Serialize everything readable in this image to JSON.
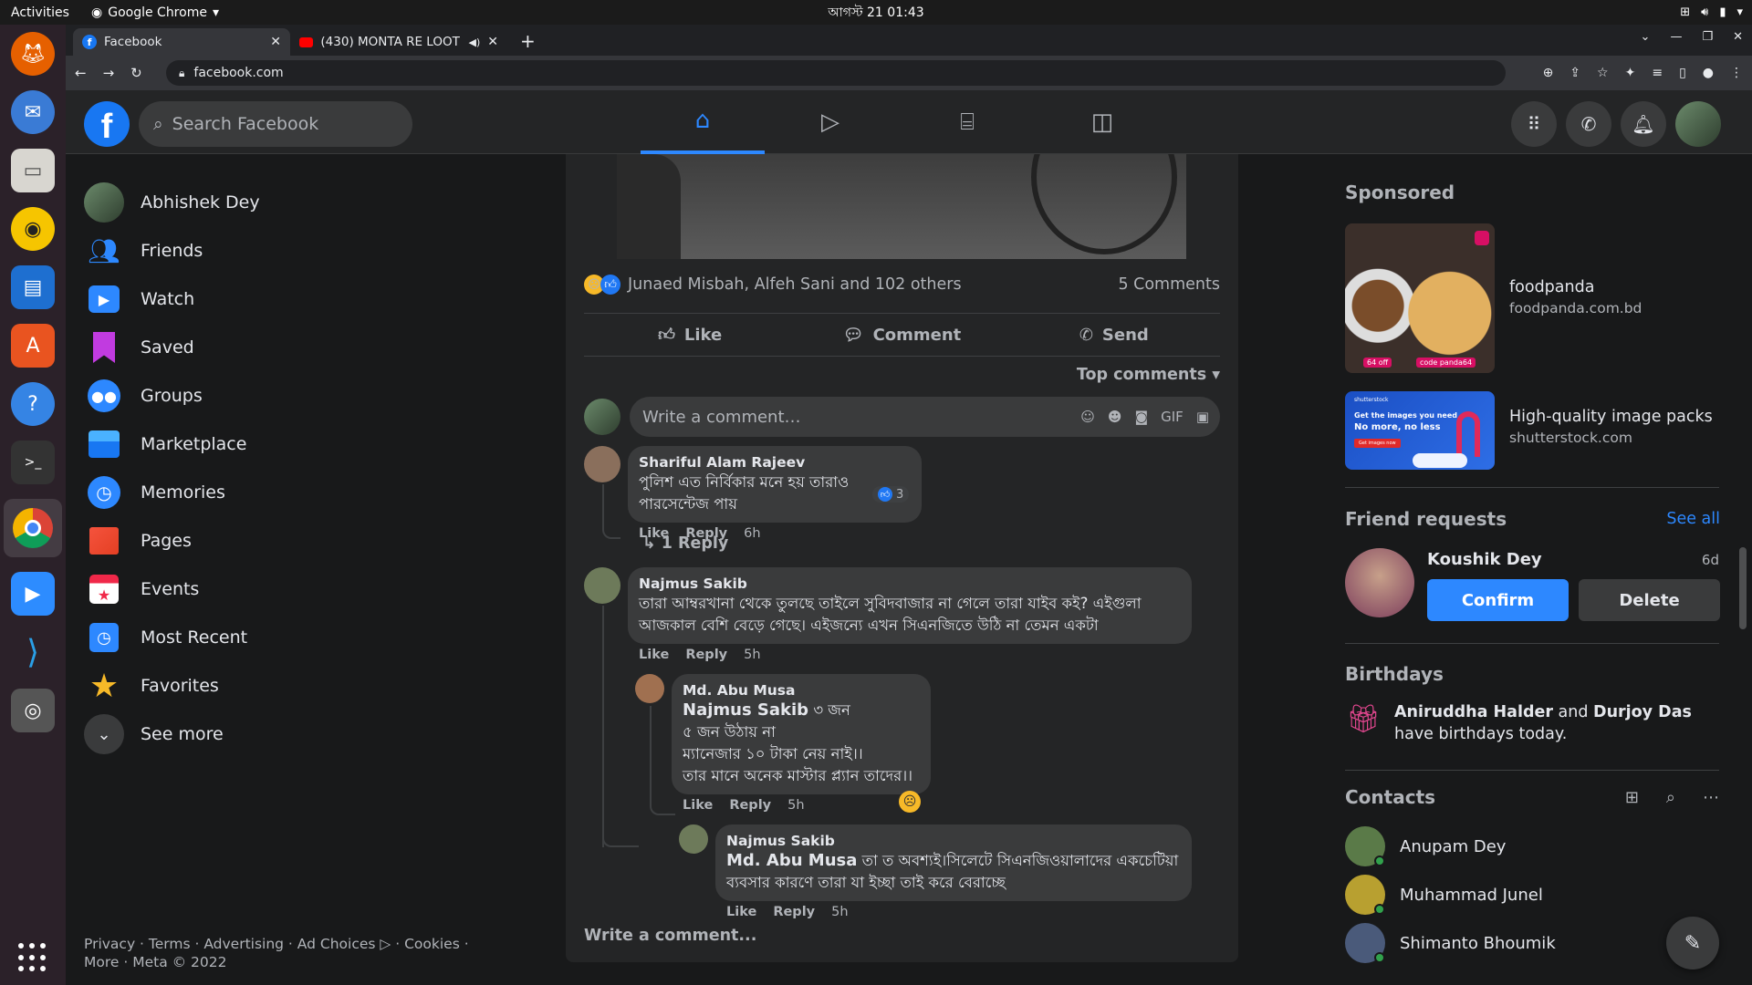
{
  "os": {
    "activities": "Activities",
    "app_name": "Google Chrome",
    "clock": "আগস্ট 21  01:43"
  },
  "browser": {
    "tabs": [
      {
        "title": "Facebook"
      },
      {
        "title": "(430) MONTA RE LOOT"
      }
    ],
    "url": "facebook.com"
  },
  "fb": {
    "search_placeholder": "Search Facebook",
    "colors": {
      "accent": "#2d88ff",
      "bg": "#18191a",
      "card": "#242526"
    }
  },
  "left_nav": {
    "items": [
      {
        "label": "Abhishek Dey",
        "icon": "profile-avatar"
      },
      {
        "label": "Friends",
        "icon": "friends-icon"
      },
      {
        "label": "Watch",
        "icon": "watch-icon"
      },
      {
        "label": "Saved",
        "icon": "bookmark-icon"
      },
      {
        "label": "Groups",
        "icon": "groups-icon"
      },
      {
        "label": "Marketplace",
        "icon": "marketplace-icon"
      },
      {
        "label": "Memories",
        "icon": "clock-icon"
      },
      {
        "label": "Pages",
        "icon": "flag-icon"
      },
      {
        "label": "Events",
        "icon": "calendar-icon"
      },
      {
        "label": "Most Recent",
        "icon": "feed-icon"
      },
      {
        "label": "Favorites",
        "icon": "star-icon"
      },
      {
        "label": "See more",
        "icon": "chevron-down-icon"
      }
    ],
    "footer": "Privacy · Terms · Advertising · Ad Choices ▷ · Cookies · More · Meta © 2022"
  },
  "post": {
    "reactions_text": "Junaed Misbah, Alfeh Sani and 102 others",
    "comments_count": "5 Comments",
    "actions": {
      "like": "Like",
      "comment": "Comment",
      "send": "Send"
    },
    "sort_label": "Top comments",
    "write_placeholder": "Write a comment…",
    "write_bottom": "Write a comment...",
    "comments": [
      {
        "author": "Shariful Alam Rajeev",
        "text": "পুলিশ এত নির্বিকার মনে হয় তারাও পারসেন্টেজ পায়",
        "like": "Like",
        "reply": "Reply",
        "time": "6h",
        "likes": "3",
        "replies_link": "1 Reply"
      },
      {
        "author": "Najmus Sakib",
        "text": "তারা আম্বরখানা থেকে তুলছে তাইলে সুবিদবাজার না গেলে তারা যাইব কই? এইগুলা আজকাল বেশি বেড়ে গেছে। এইজন্যে এখন সিএনজিতে উঠি না তেমন একটা",
        "like": "Like",
        "reply": "Reply",
        "time": "5h"
      },
      {
        "author": "Md. Abu Musa",
        "mention": "Najmus Sakib",
        "text_after_mention": " ৩ জন",
        "lines": [
          "৫ জন উঠায় না",
          "ম্যানেজার ১০ টাকা নেয় নাই।।",
          "তার মানে অনেক মাস্টার প্ল্যান তাদের।।"
        ],
        "like": "Like",
        "reply": "Reply",
        "time": "5h"
      },
      {
        "author": "Najmus Sakib",
        "mention": "Md. Abu Musa",
        "text_after_mention": " তা ত অবশ্যই।সিলেটে সিএনজিওয়ালাদের একচেটিয়া",
        "line2": "ব্যবসার কারণে তারা যা ইচ্ছা তাই করে বেরাচ্ছে",
        "like": "Like",
        "reply": "Reply",
        "time": "5h"
      }
    ]
  },
  "right": {
    "sponsored_title": "Sponsored",
    "ads": [
      {
        "name": "foodpanda",
        "domain": "foodpanda.com.bd",
        "banner_text": [
          "64 off",
          "code panda64"
        ]
      },
      {
        "name": "High-quality image packs",
        "domain": "shutterstock.com",
        "banner_text": [
          "shutterstock",
          "Get the images you need",
          "No more, no less",
          "Get images now"
        ]
      }
    ],
    "friend_requests_title": "Friend requests",
    "see_all": "See all",
    "friend_request": {
      "name": "Koushik Dey",
      "ago": "6d",
      "confirm": "Confirm",
      "delete": "Delete"
    },
    "birthdays_title": "Birthdays",
    "birthday": {
      "name1": "Aniruddha Halder",
      "and": " and ",
      "name2": "Durjoy Das",
      "rest": " have birthdays today."
    },
    "contacts_title": "Contacts",
    "contacts": [
      {
        "name": "Anupam Dey"
      },
      {
        "name": "Muhammad Junel"
      },
      {
        "name": "Shimanto Bhoumik"
      }
    ]
  }
}
